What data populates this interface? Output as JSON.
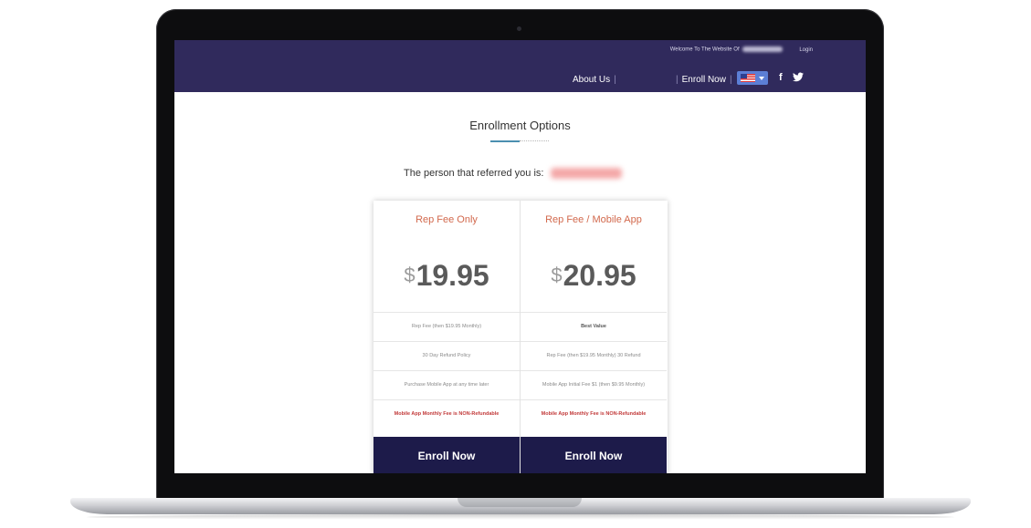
{
  "header": {
    "welcome_text": "Welcome To The Website Of",
    "login_label": "Login",
    "nav_about": "About Us",
    "nav_enroll": "Enroll Now",
    "separator": "|",
    "facebook_glyph": "f",
    "background_color": "#302a5c"
  },
  "page": {
    "title": "Enrollment Options",
    "referral_text": "The person that referred you is:"
  },
  "plans": [
    {
      "name": "Rep Fee Only",
      "currency": "$",
      "price": "19.95",
      "features": [
        "Rep Fee (then $19.95 Monthly)",
        "30 Day Refund Policy",
        "Purchase Mobile App at any time later",
        "Mobile App Monthly Fee is NON-Refundable"
      ],
      "button_label": "Enroll Now"
    },
    {
      "name": "Rep Fee / Mobile App",
      "currency": "$",
      "price": "20.95",
      "features": [
        "Best Value",
        "Rep Fee (then $19.95 Monthly) 30 Refund",
        "Mobile App Initial Fee $1 (then $9.95 Monthly)",
        "Mobile App Monthly Fee is NON-Refundable"
      ],
      "button_label": "Enroll Now"
    }
  ],
  "colors": {
    "accent_title": "#d2694d",
    "button_bg": "#1d1b4a",
    "warning": "#c23a3a"
  },
  "icons": [
    "facebook-icon",
    "twitter-icon",
    "us-flag-icon",
    "chevron-down-icon"
  ]
}
